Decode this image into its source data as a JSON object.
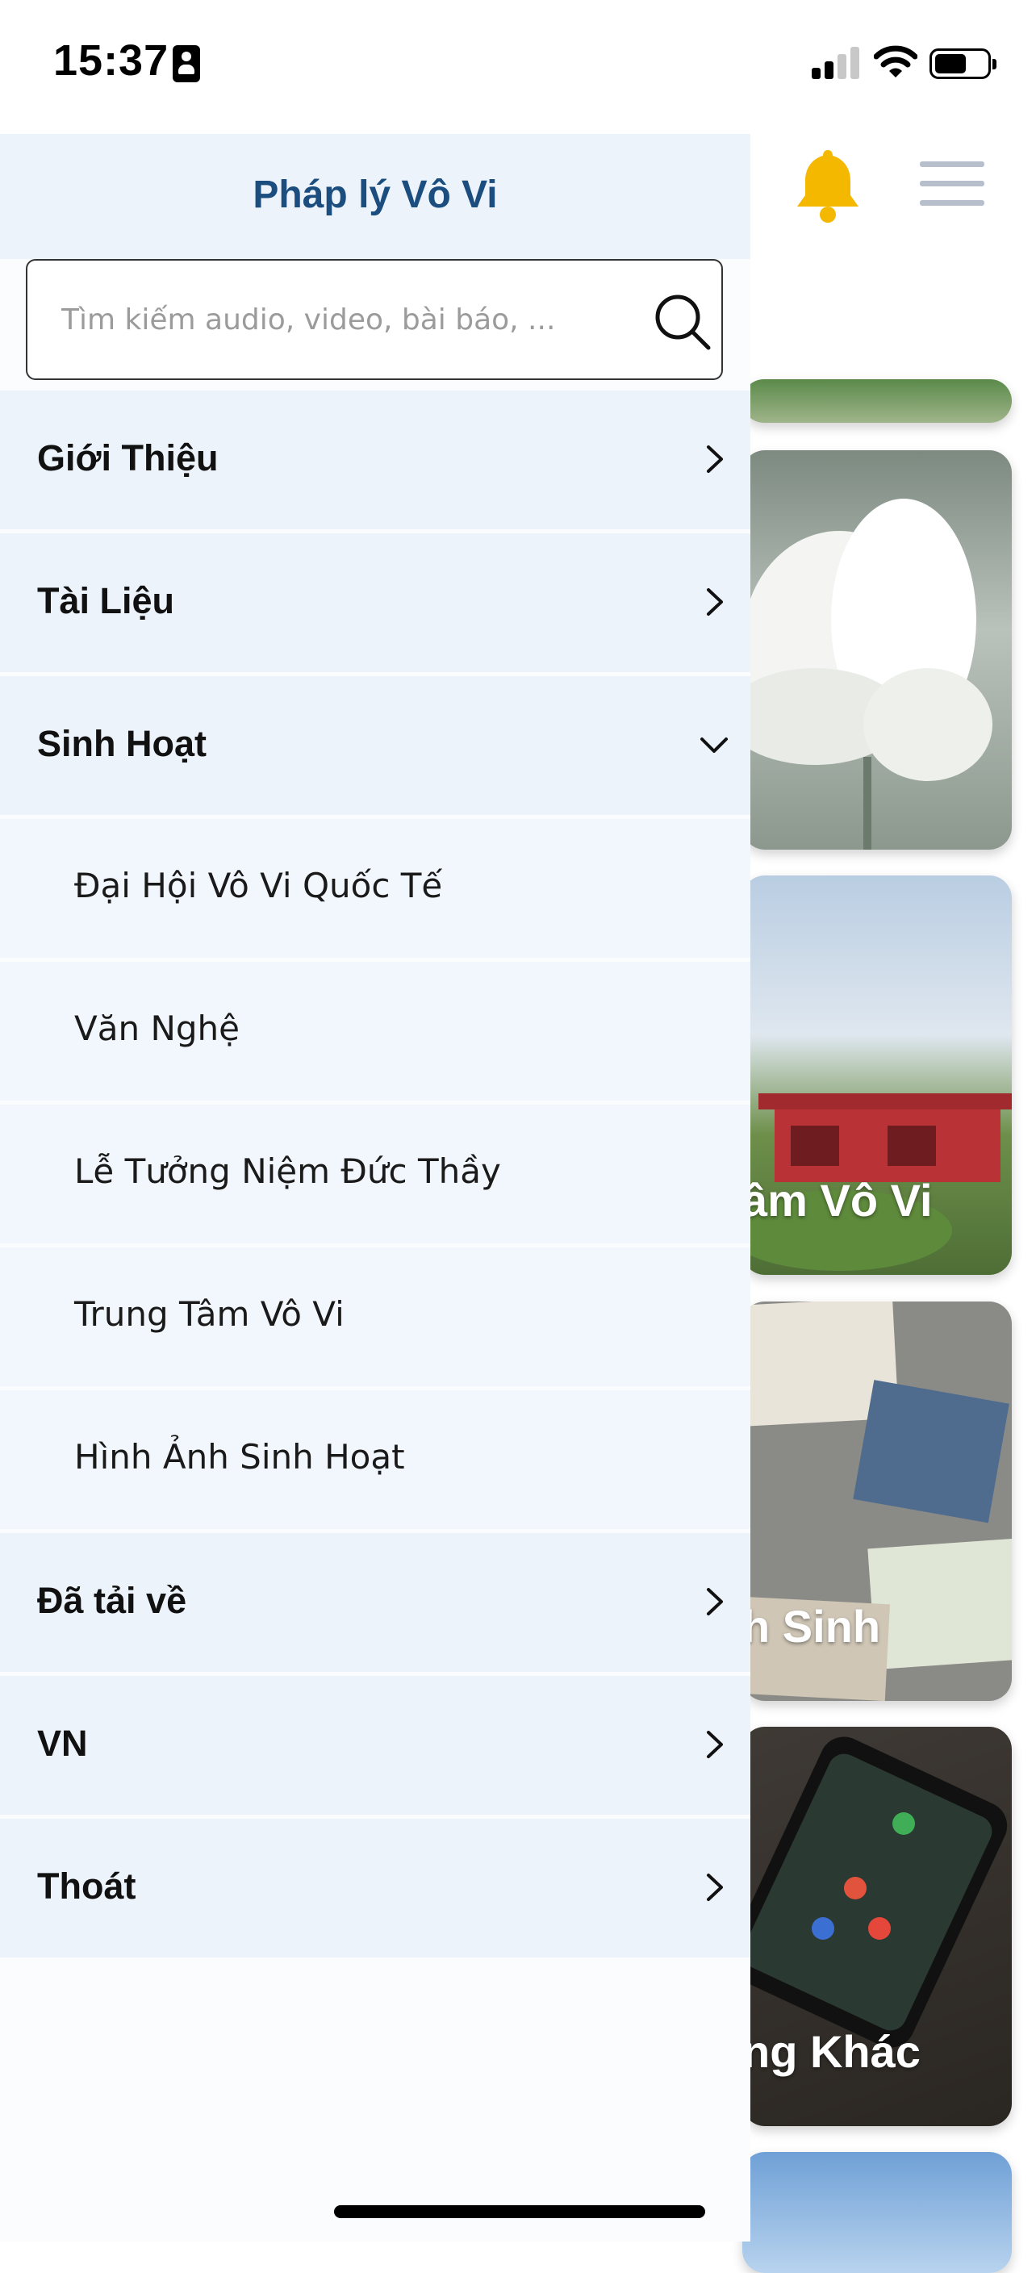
{
  "status_bar": {
    "time": "15:37"
  },
  "drawer": {
    "title": "Pháp lý Vô Vi",
    "search": {
      "placeholder": "Tìm kiếm audio, video, bài báo, ..."
    },
    "menu": [
      {
        "label": "Giới Thiệu",
        "expanded": false
      },
      {
        "label": "Tài Liệu",
        "expanded": false
      },
      {
        "label": "Sinh Hoạt",
        "expanded": true,
        "children": [
          "Đại Hội Vô Vi Quốc Tế",
          "Văn Nghệ",
          "Lễ Tưởng Niệm Đức Thầy",
          "Trung Tâm Vô Vi",
          "Hình Ảnh Sinh Hoạt"
        ]
      },
      {
        "label": "Đã tải về",
        "expanded": false
      },
      {
        "label": "VN",
        "expanded": false
      },
      {
        "label": "Thoát",
        "expanded": false
      }
    ]
  },
  "background": {
    "cards": [
      {
        "label": ""
      },
      {
        "label": ""
      },
      {
        "label": "âm Vô Vi"
      },
      {
        "label": "h Sinh"
      },
      {
        "label": "ng Khác"
      },
      {
        "label": ""
      }
    ]
  },
  "colors": {
    "accent_title": "#1b4d7e",
    "bell": "#f5b800",
    "menu_bg": "#edf3fb",
    "submenu_bg": "#f2f7fd"
  },
  "icons": {
    "bell": "bell-icon",
    "menu": "hamburger-icon",
    "search": "search-icon",
    "chevron_right": "chevron-right-icon",
    "chevron_down": "chevron-down-icon"
  }
}
